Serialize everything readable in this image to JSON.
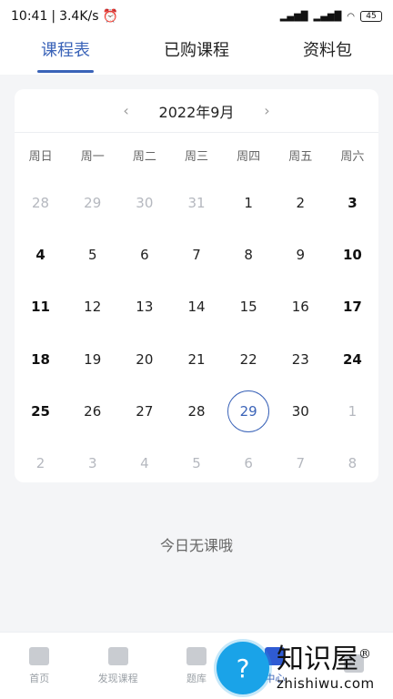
{
  "status": {
    "time": "10:41",
    "speed": "3.4K/s",
    "battery": "45"
  },
  "tabs": [
    {
      "label": "课程表",
      "active": true
    },
    {
      "label": "已购课程",
      "active": false
    },
    {
      "label": "资料包",
      "active": false
    }
  ],
  "calendar": {
    "month_title": "2022年9月",
    "prev": "‹",
    "next": "›",
    "weekdays": [
      "周日",
      "周一",
      "周二",
      "周三",
      "周四",
      "周五",
      "周六"
    ],
    "days": [
      {
        "d": "28",
        "muted": true
      },
      {
        "d": "29",
        "muted": true
      },
      {
        "d": "30",
        "muted": true
      },
      {
        "d": "31",
        "muted": true
      },
      {
        "d": "1"
      },
      {
        "d": "2"
      },
      {
        "d": "3",
        "weekend": true
      },
      {
        "d": "4",
        "weekend": true
      },
      {
        "d": "5"
      },
      {
        "d": "6"
      },
      {
        "d": "7"
      },
      {
        "d": "8"
      },
      {
        "d": "9"
      },
      {
        "d": "10",
        "weekend": true
      },
      {
        "d": "11",
        "weekend": true
      },
      {
        "d": "12"
      },
      {
        "d": "13"
      },
      {
        "d": "14"
      },
      {
        "d": "15"
      },
      {
        "d": "16"
      },
      {
        "d": "17",
        "weekend": true
      },
      {
        "d": "18",
        "weekend": true
      },
      {
        "d": "19"
      },
      {
        "d": "20"
      },
      {
        "d": "21"
      },
      {
        "d": "22"
      },
      {
        "d": "23"
      },
      {
        "d": "24",
        "weekend": true
      },
      {
        "d": "25",
        "weekend": true
      },
      {
        "d": "26"
      },
      {
        "d": "27"
      },
      {
        "d": "28"
      },
      {
        "d": "29",
        "today": true
      },
      {
        "d": "30"
      },
      {
        "d": "1",
        "muted": true
      },
      {
        "d": "2",
        "muted": true
      },
      {
        "d": "3",
        "muted": true
      },
      {
        "d": "4",
        "muted": true
      },
      {
        "d": "5",
        "muted": true
      },
      {
        "d": "6",
        "muted": true
      },
      {
        "d": "7",
        "muted": true
      },
      {
        "d": "8",
        "muted": true
      }
    ]
  },
  "empty_text": "今日无课哦",
  "bottom_nav": [
    {
      "label": "首页",
      "icon": "home-icon",
      "active": false
    },
    {
      "label": "发现课程",
      "icon": "book-icon",
      "active": false
    },
    {
      "label": "题库",
      "icon": "library-icon",
      "active": false
    },
    {
      "label": "中心",
      "icon": "study-center-icon",
      "active": true
    },
    {
      "label": "",
      "icon": "profile-icon",
      "active": false
    }
  ],
  "watermark": {
    "cn": "知识屋",
    "en": "zhishiwu.com",
    "reg": "®"
  },
  "colors": {
    "accent": "#3a63b8",
    "background": "#f4f5f7",
    "muted": "#b5b8bf"
  }
}
